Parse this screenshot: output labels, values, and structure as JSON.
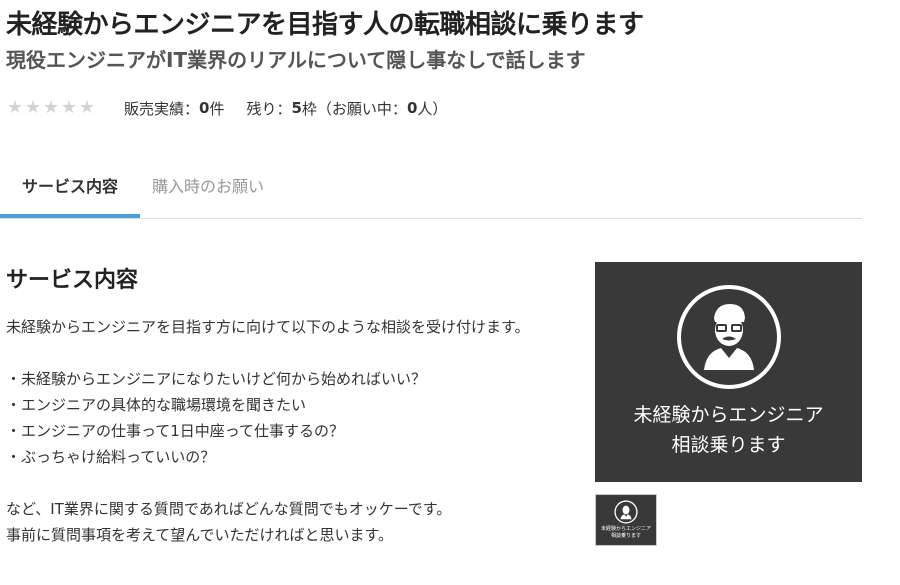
{
  "header": {
    "title": "未経験からエンジニアを目指す人の転職相談に乗ります",
    "subtitle": "現役エンジニアがIT業界のリアルについて隠し事なしで話します"
  },
  "stats": {
    "rating_stars": 0,
    "sales_label": "販売実績：",
    "sales_value": "0",
    "sales_unit": "件",
    "remaining_label": "残り：",
    "remaining_value": "5",
    "remaining_unit": "枠（お願い中：",
    "requesting_value": "0",
    "requesting_unit": "人）"
  },
  "tabs": [
    {
      "label": "サービス内容",
      "active": true
    },
    {
      "label": "購入時のお願い",
      "active": false
    }
  ],
  "section": {
    "title": "サービス内容",
    "paragraphs": [
      "未経験からエンジニアを目指す方に向けて以下のような相談を受け付けます。",
      "",
      "・未経験からエンジニアになりたいけど何から始めればいい？",
      "・エンジニアの具体的な職場環境を聞きたい",
      "・エンジニアの仕事って1日中座って仕事するの？",
      "・ぶっちゃけ給料っていいの？",
      "",
      "など、IT業界に関する質問であればどんな質問でもオッケーです。",
      "事前に質問事項を考えて望んでいただければと思います。"
    ]
  },
  "image": {
    "caption_line1": "未経験からエンジニア",
    "caption_line2": "相談乗ります",
    "icon": "person-with-glasses-icon",
    "background": "#393939"
  },
  "colors": {
    "accent": "#4a9fd8",
    "star_empty": "#d3d3d3"
  }
}
